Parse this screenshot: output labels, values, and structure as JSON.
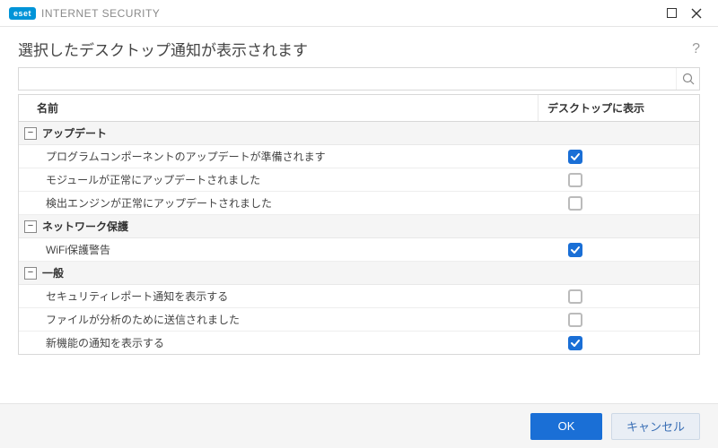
{
  "titlebar": {
    "brand_short": "eset",
    "brand_text": "INTERNET SECURITY"
  },
  "heading": "選択したデスクトップ通知が表示されます",
  "columns": {
    "name": "名前",
    "show": "デスクトップに表示"
  },
  "groups": [
    {
      "label": "アップデート",
      "items": [
        {
          "label": "プログラムコンポーネントのアップデートが準備されます",
          "checked": true
        },
        {
          "label": "モジュールが正常にアップデートされました",
          "checked": false
        },
        {
          "label": "検出エンジンが正常にアップデートされました",
          "checked": false
        }
      ]
    },
    {
      "label": "ネットワーク保護",
      "items": [
        {
          "label": "WiFi保護警告",
          "checked": true
        }
      ]
    },
    {
      "label": "一般",
      "items": [
        {
          "label": "セキュリティレポート通知を表示する",
          "checked": false
        },
        {
          "label": "ファイルが分析のために送信されました",
          "checked": false
        },
        {
          "label": "新機能の通知を表示する",
          "checked": true
        }
      ]
    }
  ],
  "buttons": {
    "ok": "OK",
    "cancel": "キャンセル"
  },
  "search": {
    "placeholder": ""
  }
}
